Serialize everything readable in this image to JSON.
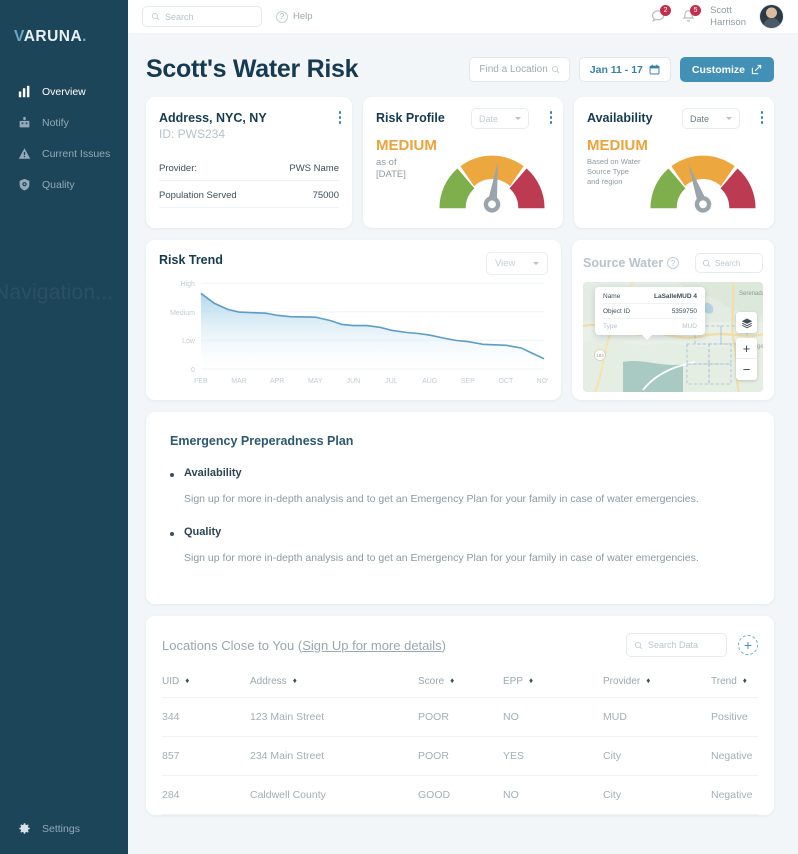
{
  "brand": {
    "name_v": "V",
    "name_rest": "ARUNA",
    "dot": "."
  },
  "sidebar": {
    "items": [
      {
        "label": "Overview",
        "icon": "bar-chart-icon",
        "active": true
      },
      {
        "label": "Notify",
        "icon": "broadcast-icon",
        "active": false
      },
      {
        "label": "Current Issues",
        "icon": "warning-triangle-icon",
        "active": false
      },
      {
        "label": "Quality",
        "icon": "shield-icon",
        "active": false
      }
    ],
    "overlay_text": "Navigation...",
    "settings_label": "Settings"
  },
  "topbar": {
    "search_placeholder": "Search",
    "help_label": "Help",
    "help_icon": "question-circle-icon",
    "messages_icon": "chat-bubble-icon",
    "messages_count": "2",
    "notifications_icon": "bell-icon",
    "notifications_count": "5",
    "user_name_line1": "Scott",
    "user_name_line2": "Harrison"
  },
  "header": {
    "title": "Scott's Water Risk",
    "find_location_label": "Find a Location",
    "find_location_icon": "search-icon",
    "date_range_label": "Jan 11 - 17",
    "date_range_icon": "calendar-icon",
    "customize_label": "Customize",
    "customize_icon": "edit-square-icon"
  },
  "address_card": {
    "title": "Address, NYC, NY",
    "id": "ID: PWS234",
    "rows": [
      {
        "key": "Provider:",
        "value": "PWS Name"
      },
      {
        "key": "Population Served",
        "value": "75000"
      }
    ]
  },
  "risk_profile": {
    "title": "Risk Profile",
    "date_label": "Date",
    "status": "MEDIUM",
    "sub_line1": "as of",
    "sub_line2": "[DATE]",
    "gauge_needle_deg": 8
  },
  "availability": {
    "title": "Availability",
    "date_label": "Date",
    "status": "MEDIUM",
    "sub_line1": "Based on Water",
    "sub_line2": "Source Type",
    "sub_line3": "and region",
    "gauge_needle_deg": -20
  },
  "gauge_colors": {
    "low": "#7fae4c",
    "medium": "#eda73f",
    "high": "#bc3a52",
    "needle": "#9aa5ab"
  },
  "risk_trend": {
    "title": "Risk Trend",
    "view_label": "View"
  },
  "source_water": {
    "title": "Source Water",
    "info_icon": "question-circle-icon",
    "search_placeholder": "Search",
    "popup": [
      {
        "key": "Name",
        "value": "LaSalleMUD 4"
      },
      {
        "key": "Object ID",
        "value": "5359750"
      },
      {
        "key": "Type",
        "value": "MUD"
      }
    ],
    "map_label": "Serenada",
    "map_label2": "Geo",
    "layers_icon": "layers-icon",
    "zoom_in": "+",
    "zoom_out": "−"
  },
  "epp": {
    "title": "Emergency Preperadness Plan",
    "items": [
      {
        "heading": "Availability",
        "body": "Sign up for more in-depth analysis and to get an Emergency Plan for your family in case of water emergencies."
      },
      {
        "heading": "Quality",
        "body": "Sign up for more in-depth analysis and to get an Emergency Plan for your family in case of water emergencies."
      }
    ]
  },
  "locations_table": {
    "title_plain": "Locations Close to You (",
    "title_link": "Sign Up for more details",
    "title_close": ")",
    "search_placeholder": "Search Data",
    "add_icon": "plus-circle-icon",
    "columns": [
      {
        "label": "UID",
        "sortable": true
      },
      {
        "label": "Address",
        "sortable": true
      },
      {
        "label": "Score",
        "sortable": true
      },
      {
        "label": "EPP",
        "sortable": true
      },
      {
        "label": "Provider",
        "sortable": true
      },
      {
        "label": "Trend",
        "sortable": true
      }
    ],
    "rows": [
      {
        "uid": "344",
        "address": "123 Main Street",
        "score": "POOR",
        "epp": "NO",
        "provider": "MUD",
        "trend": "Positive"
      },
      {
        "uid": "857",
        "address": "234 Main Street",
        "score": "POOR",
        "epp": "YES",
        "provider": "City",
        "trend": "Negative"
      },
      {
        "uid": "284",
        "address": "Caldwell County",
        "score": "GOOD",
        "epp": "NO",
        "provider": "City",
        "trend": "Negative"
      }
    ]
  },
  "chart_data": {
    "type": "area",
    "title": "Risk Trend",
    "xlabel": "",
    "ylabel": "",
    "categories": [
      "FEB",
      "MAR",
      "APR",
      "MAY",
      "JUN",
      "JUL",
      "AUG",
      "SEP",
      "OCT",
      "NOV"
    ],
    "ytick_labels": [
      "High",
      "Medium",
      "Low",
      "0"
    ],
    "ylim": [
      0,
      3.2
    ],
    "grid": true,
    "legend": "none",
    "line_color": "#5b9dc4",
    "fill_top": "#bcdcee",
    "fill_bottom": "#ffffff",
    "x": [
      0,
      0.35,
      0.7,
      1.0,
      1.35,
      1.7,
      2.0,
      2.35,
      2.7,
      3.0,
      3.4,
      3.7,
      4.0,
      4.35,
      4.7,
      5.0,
      5.4,
      5.7,
      6.0,
      6.4,
      6.7,
      7.0,
      7.4,
      7.7,
      8.0,
      8.4,
      8.7,
      9.0
    ],
    "values": [
      2.82,
      2.45,
      2.22,
      2.12,
      2.1,
      2.08,
      2.0,
      1.95,
      1.94,
      1.93,
      1.8,
      1.66,
      1.62,
      1.62,
      1.55,
      1.44,
      1.36,
      1.32,
      1.26,
      1.14,
      1.06,
      1.02,
      0.92,
      0.9,
      0.88,
      0.78,
      0.58,
      0.38
    ]
  }
}
